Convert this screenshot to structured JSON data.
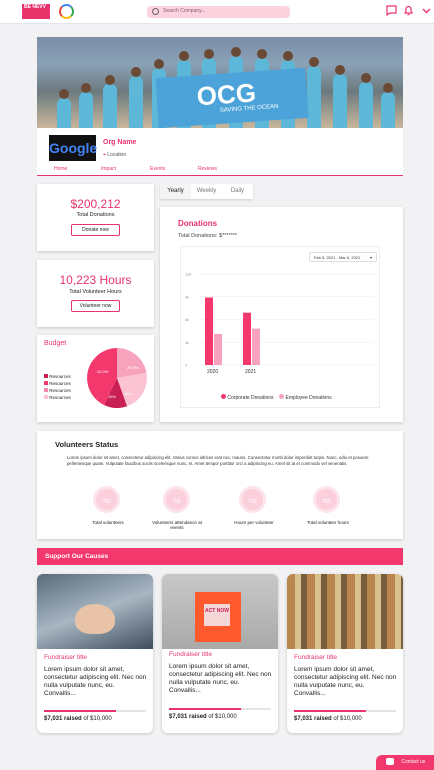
{
  "brand": {
    "logo_text": "BE NEVV",
    "accent": "#e8336b"
  },
  "search": {
    "placeholder": "Search Company..."
  },
  "org": {
    "name": "Org Name",
    "location": "Location",
    "banner_text": "OCG",
    "banner_sub": "SAVING THE OCEAN",
    "logo_text": "Google"
  },
  "tabs": [
    {
      "label": "Home"
    },
    {
      "label": "Impact"
    },
    {
      "label": "Events"
    },
    {
      "label": "Reviews"
    }
  ],
  "stats": {
    "donations_value": "$200,212",
    "donations_label": "Total Donations",
    "donate_btn": "Donate now",
    "hours_value": "10,223 Hours",
    "hours_label": "Total Volunteer Hours",
    "volunteer_btn": "Volunteer now"
  },
  "budget": {
    "title": "Budget",
    "legend": [
      "Resources",
      "Resources",
      "Resources",
      "Resources"
    ],
    "slices": [
      "42.0%",
      "28.0%",
      "18%",
      "16%"
    ]
  },
  "period_tabs": [
    {
      "label": "Yearly"
    },
    {
      "label": "Weekly"
    },
    {
      "label": "Daily"
    }
  ],
  "donations_chart": {
    "title": "Donations",
    "subtitle": "Total Donations: $*******",
    "date_range": "Feb 5, 2021 - Mar 5, 2021"
  },
  "chart_data": {
    "type": "bar",
    "categories": [
      "2020",
      "2021"
    ],
    "series": [
      {
        "name": "Corporate Donations",
        "values": [
          8.9,
          6.9
        ]
      },
      {
        "name": "Employee Donations",
        "values": [
          4.1,
          4.8
        ]
      }
    ],
    "yticks": [
      "0",
      "3k",
      "6k",
      "9k",
      "12k"
    ],
    "ylim": [
      0,
      12
    ],
    "colors": [
      "#f2386d",
      "#f8a3bd"
    ],
    "legend_position": "bottom"
  },
  "volunteers": {
    "title": "Volunteers Status",
    "text": "Lorem ipsum dolor sit amet, consectetur adipiscing elit. Varius cursus ultrices erat nec, mauris. Consectetur morbi dolor imperdiet turpis. Nunc, odio et posuere pellentesque quam. Vulputate faucibus sociis scelerisque nunc, et. Amet tempor porttitor orci a adipiscing eu. Amet sit at et commodo vel venenatis.",
    "items": [
      {
        "value": "755",
        "label": "Total volunteers"
      },
      {
        "value": "755",
        "label": "Volunteers attendance at events"
      },
      {
        "value": "755",
        "label": "Hours per volunteer"
      },
      {
        "value": "755",
        "label": "Total volunteer hours"
      }
    ]
  },
  "causes": {
    "heading": "Support Our Causes",
    "items": [
      {
        "title": "Fundraiser title",
        "text": "Lorem ipsum dolor sit amet, consectetur adipiscing elit. Nec non nulla vulputate nunc, eu. Convallis...",
        "raised": "$7,031 raised",
        "goal": "of $10,000",
        "progress": 0.7031
      },
      {
        "title": "Fundraiser title",
        "text": "Lorem ipsum dolor sit amet, consectetur adipiscing elit. Nec non nulla vulputate nunc, eu. Convallis...",
        "raised": "$7,031 raised",
        "goal": "of $10,000",
        "progress": 0.7031
      },
      {
        "title": "Fundraiser title",
        "text": "Lorem ipsum dolor sit amet, consectetur adipiscing elit. Nec non nulla vulputate nunc, eu. Convallis...",
        "raised": "$7,031 raised",
        "goal": "of $10,000",
        "progress": 0.7031
      }
    ]
  },
  "contact": {
    "label": "Contact us"
  },
  "donation_box_text": "ACT NOW"
}
